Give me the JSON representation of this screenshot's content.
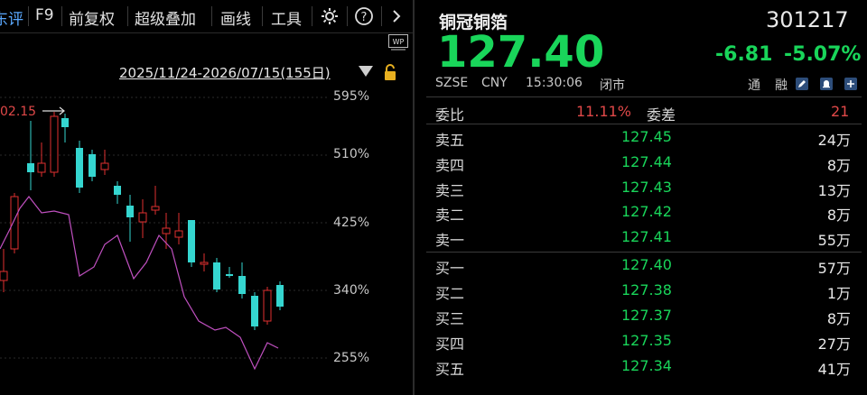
{
  "toolbar": {
    "items": [
      "评",
      "F9",
      "前复权",
      "超级叠加",
      "画线",
      "工具"
    ],
    "partial_prefix": "东"
  },
  "chart": {
    "range_label": "2025/11/24-2026/07/15(155日)",
    "peak_label": "02.15",
    "pct_ticks": [
      "595%",
      "510%",
      "425%",
      "340%",
      "255%"
    ],
    "up_color": "#e03030",
    "down_color": "#35d6d0",
    "line_color": "#c050c0"
  },
  "stock": {
    "name": "铜冠铜箔",
    "code": "301217",
    "price": "127.40",
    "change": "-6.81",
    "change_pct": "-5.07%",
    "market": "SZSE",
    "currency": "CNY",
    "time": "15:30:06",
    "status": "闭市",
    "tag1": "通",
    "tag2": "融"
  },
  "orderbook": {
    "weibi_label": "委比",
    "weibi_value": "11.11%",
    "weicha_label": "委差",
    "weicha_value": "21",
    "asks": [
      {
        "label": "卖五",
        "price": "127.45",
        "vol": "24万"
      },
      {
        "label": "卖四",
        "price": "127.44",
        "vol": "8万"
      },
      {
        "label": "卖三",
        "price": "127.43",
        "vol": "13万"
      },
      {
        "label": "卖二",
        "price": "127.42",
        "vol": "8万"
      },
      {
        "label": "卖一",
        "price": "127.41",
        "vol": "55万"
      }
    ],
    "bids": [
      {
        "label": "买一",
        "price": "127.40",
        "vol": "57万"
      },
      {
        "label": "买二",
        "price": "127.38",
        "vol": "1万"
      },
      {
        "label": "买三",
        "price": "127.37",
        "vol": "8万"
      },
      {
        "label": "买四",
        "price": "127.35",
        "vol": "27万"
      },
      {
        "label": "买五",
        "price": "127.34",
        "vol": "41万"
      }
    ]
  }
}
